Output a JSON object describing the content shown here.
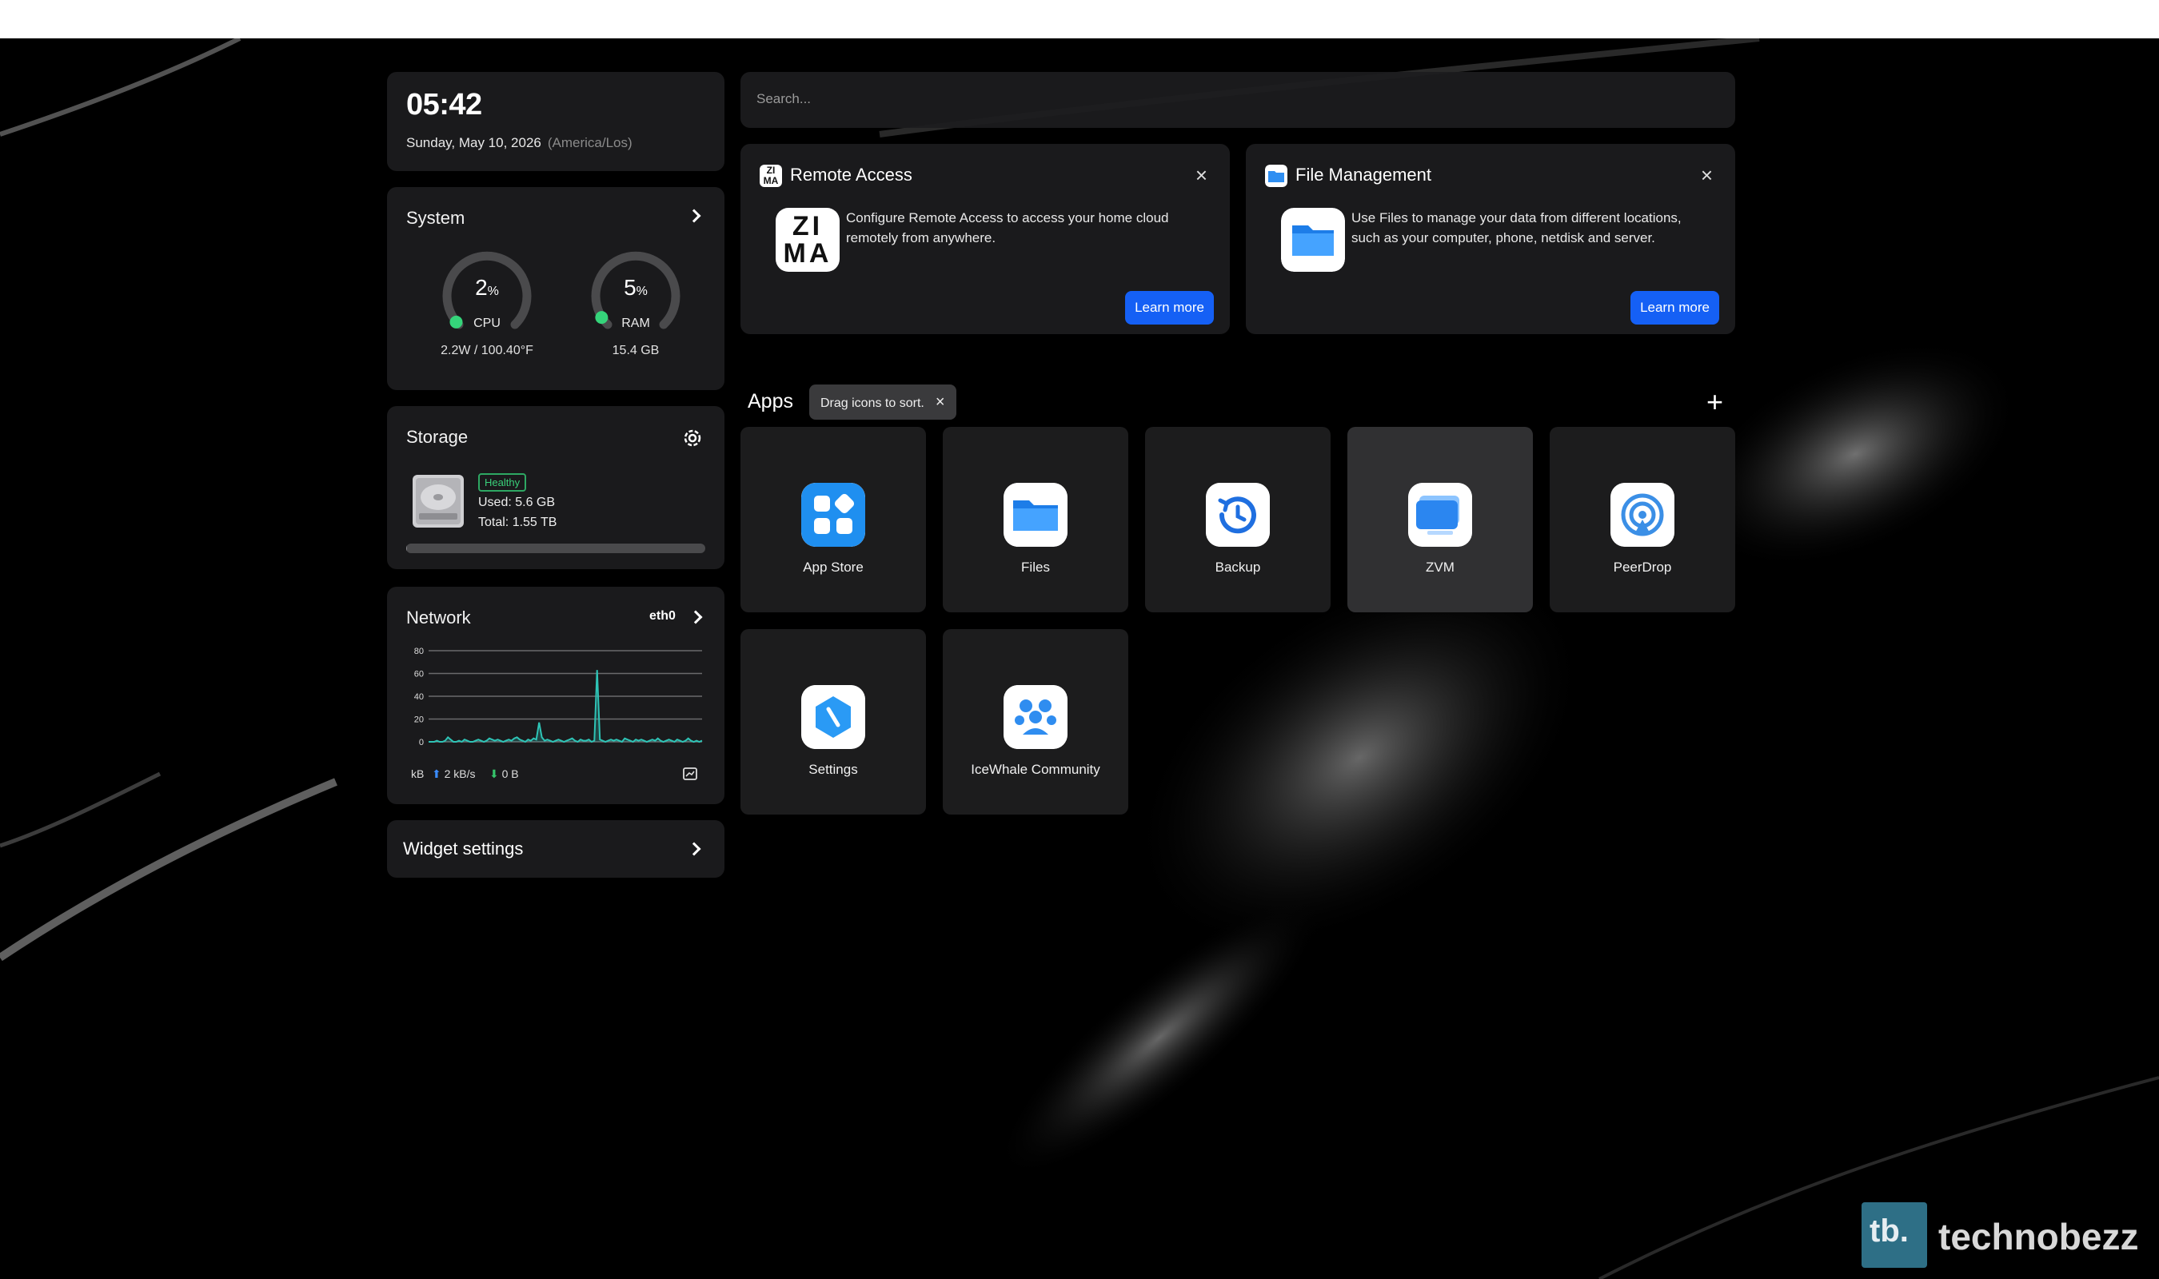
{
  "clock": {
    "time": "05:42",
    "date": "Sunday, May 10, 2026",
    "timezone": "(America/Los)"
  },
  "system": {
    "title": "System",
    "cpu": {
      "value": "2",
      "unit": "%",
      "label": "CPU",
      "detail": "2.2W / 100.40°F",
      "percent": 2
    },
    "ram": {
      "value": "5",
      "unit": "%",
      "label": "RAM",
      "detail": "15.4 GB",
      "percent": 5
    }
  },
  "storage": {
    "title": "Storage",
    "status": "Healthy",
    "used": "Used: 5.6 GB",
    "total": "Total: 1.55 TB",
    "fill_fraction": 0.004
  },
  "network": {
    "title": "Network",
    "interface": "eth0",
    "unit": "kB",
    "upload": "2 kB/s",
    "download": "0 B",
    "chart_data": {
      "type": "line",
      "ylim": [
        0,
        80
      ],
      "yticks": [
        "0",
        "20",
        "40",
        "60",
        "80"
      ],
      "values": [
        0,
        0,
        0,
        1,
        0,
        0,
        1,
        4,
        2,
        0,
        0,
        1,
        0,
        2,
        1,
        0,
        0,
        1,
        2,
        1,
        0,
        1,
        3,
        2,
        1,
        2,
        1,
        0,
        1,
        2,
        1,
        3,
        4,
        2,
        1,
        0,
        2,
        1,
        3,
        2,
        17,
        4,
        1,
        2,
        1,
        0,
        1,
        2,
        1,
        0,
        1,
        2,
        3,
        1,
        0,
        2,
        1,
        1,
        2,
        0,
        1,
        63,
        2,
        1,
        0,
        1,
        2,
        1,
        2,
        1,
        0,
        3,
        2,
        1,
        0,
        2,
        1,
        2,
        1,
        0,
        1,
        2,
        1,
        3,
        1,
        0,
        1,
        2,
        1,
        0,
        2,
        1,
        0,
        1,
        3,
        1,
        0,
        1,
        0,
        1
      ]
    }
  },
  "widget_settings": {
    "label": "Widget settings"
  },
  "search": {
    "placeholder": "Search..."
  },
  "cards": [
    {
      "title": "Remote Access",
      "description": "Configure Remote Access to access your home cloud remotely from anywhere.",
      "button": "Learn more",
      "logo_text": "ZI MA",
      "icon": "zima-icon"
    },
    {
      "title": "File Management",
      "description": "Use Files to manage your data from different locations, such as your computer, phone, netdisk and server.",
      "button": "Learn more",
      "icon": "folder-icon"
    }
  ],
  "apps": {
    "title": "Apps",
    "tip": "Drag icons to sort.",
    "add": "+",
    "items": [
      {
        "name": "App Store",
        "icon": "app-store-icon"
      },
      {
        "name": "Files",
        "icon": "folder-icon"
      },
      {
        "name": "Backup",
        "icon": "backup-icon"
      },
      {
        "name": "ZVM",
        "icon": "zvm-icon"
      },
      {
        "name": "PeerDrop",
        "icon": "peerdrop-icon"
      },
      {
        "name": "Settings",
        "icon": "settings-icon"
      },
      {
        "name": "IceWhale Community",
        "icon": "community-icon"
      }
    ]
  },
  "watermark": {
    "logo": "tb.",
    "text": "technobezz"
  },
  "colors": {
    "accent": "#1560f5",
    "healthy": "#3ad07a",
    "gauge": "#35d47a",
    "chart_line": "#2ec4b6"
  }
}
